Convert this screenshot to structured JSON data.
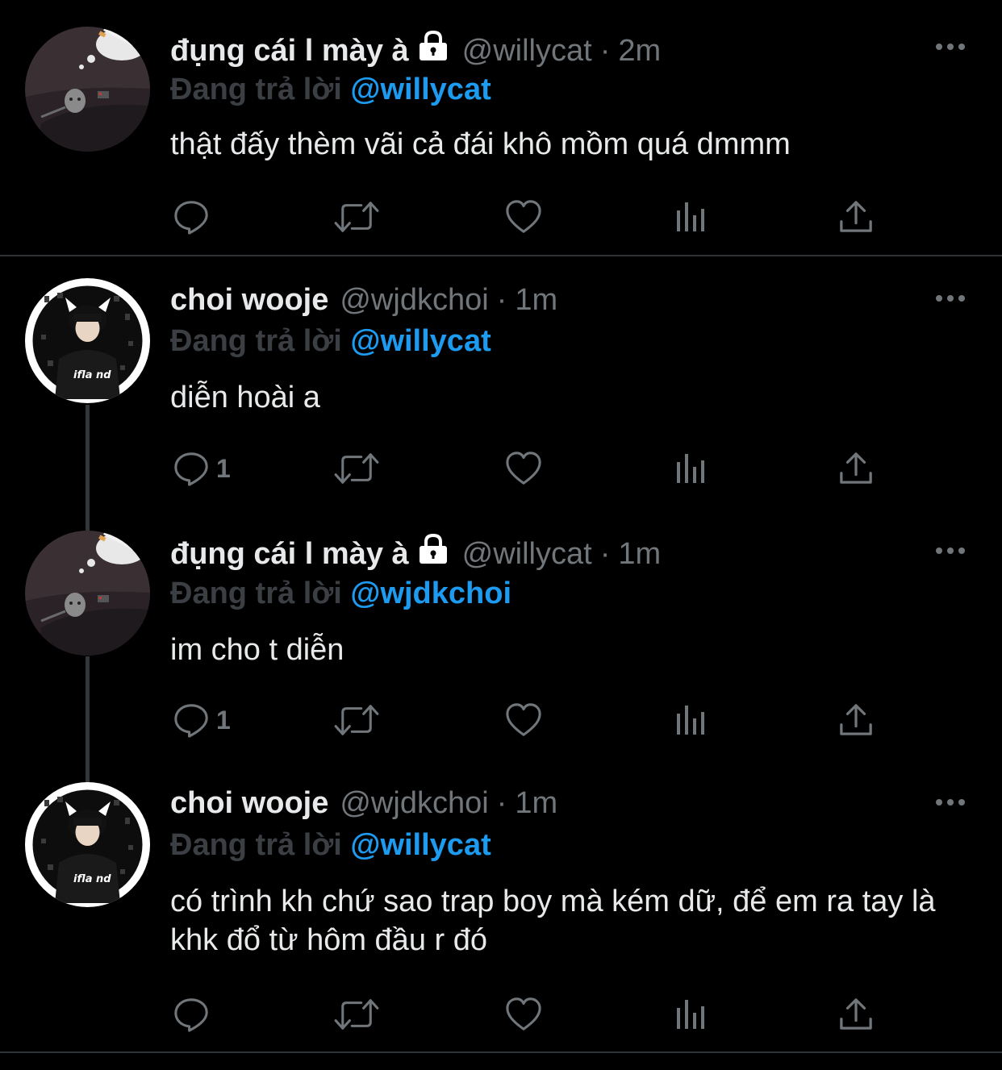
{
  "tweets": [
    {
      "display_name": "đụng cái l mày à",
      "locked": true,
      "handle": "@willycat",
      "separator": "·",
      "time": "2m",
      "replying_label": "Đang trả lời",
      "replying_to": "@willycat",
      "text": "thật đấy thèm vãi cả đái khô mồm quá dmmm",
      "reply_count": ""
    },
    {
      "display_name": "choi wooje",
      "locked": false,
      "handle": "@wjdkchoi",
      "separator": "·",
      "time": "1m",
      "replying_label": "Đang trả lời",
      "replying_to": "@willycat",
      "text": "diễn hoài a",
      "reply_count": "1"
    },
    {
      "display_name": "đụng cái l mày à",
      "locked": true,
      "handle": "@willycat",
      "separator": "·",
      "time": "1m",
      "replying_label": "Đang trả lời",
      "replying_to": "@wjdkchoi",
      "text": "im cho t diễn",
      "reply_count": "1"
    },
    {
      "display_name": "choi wooje",
      "locked": false,
      "handle": "@wjdkchoi",
      "separator": "·",
      "time": "1m",
      "replying_label": "Đang trả lời",
      "replying_to": "@willycat",
      "text": "có trình kh chứ sao trap boy mà kém dữ, để em ra tay là khk đổ từ hôm đầu r đó",
      "reply_count": ""
    }
  ],
  "avatar_text": "ifla nd",
  "colors": {
    "background": "#000000",
    "text": "#e7e9ea",
    "secondary": "#71767b",
    "link": "#1d9bf0",
    "divider": "#2f3336"
  },
  "icons": [
    "reply-icon",
    "retweet-icon",
    "like-icon",
    "views-icon",
    "share-icon",
    "more-icon",
    "lock-icon"
  ]
}
